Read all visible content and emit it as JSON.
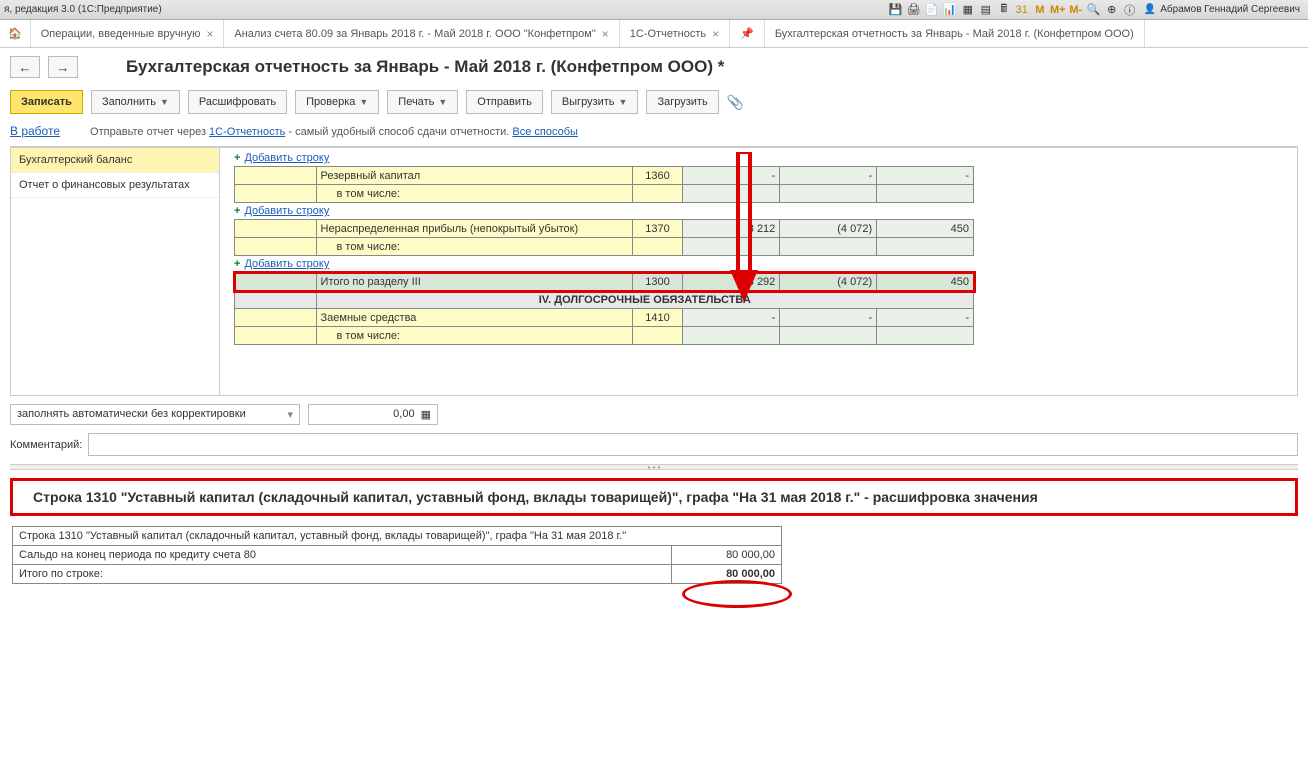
{
  "titlebar": {
    "app": "я, редакция 3.0  (1С:Предприятие)",
    "user": "Абрамов Геннадий Сергеевич",
    "btns": [
      "M",
      "M+",
      "M-"
    ]
  },
  "tabs": {
    "t1": "Операции, введенные вручную",
    "t2": "Анализ счета 80.09 за Январь 2018 г. - Май 2018 г. ООО \"Конфетпром\"",
    "t3": "1С-Отчетность",
    "t4": "Бухгалтерская отчетность за Январь - Май 2018 г. (Конфетпром ООО)"
  },
  "page": {
    "title": "Бухгалтерская отчетность за Январь - Май 2018 г. (Конфетпром ООО) *"
  },
  "toolbar": {
    "save": "Записать",
    "fill": "Заполнить",
    "decode": "Расшифровать",
    "check": "Проверка",
    "print": "Печать",
    "send": "Отправить",
    "upload": "Выгрузить",
    "load": "Загрузить"
  },
  "status": "В работе",
  "info": {
    "pre": "Отправьте отчет через ",
    "link1": "1С-Отчетность",
    "mid": " - самый удобный способ сдачи отчетности. ",
    "link2": "Все способы"
  },
  "leftpanel": {
    "i1": "Бухгалтерский баланс",
    "i2": "Отчет о финансовых результатах"
  },
  "grid": {
    "addrow": "Добавить строку",
    "r1": {
      "lbl": "Резервный капитал",
      "code": "1360",
      "v1": "-",
      "v2": "-",
      "v3": "-"
    },
    "r1b": {
      "lbl": "в том числе:"
    },
    "r2": {
      "lbl": "Нераспределенная прибыль (непокрытый убыток)",
      "code": "1370",
      "v1": "8 212",
      "v2": "(4 072)",
      "v3": "450"
    },
    "r2b": {
      "lbl": "в том числе:"
    },
    "r3": {
      "lbl": "Итого по разделу III",
      "code": "1300",
      "v1": "8 292",
      "v2": "(4 072)",
      "v3": "450"
    },
    "sec": {
      "lbl": "IV. ДОЛГОСРОЧНЫЕ ОБЯЗАТЕЛЬСТВА"
    },
    "r4": {
      "lbl": "Заемные средства",
      "code": "1410",
      "v1": "-",
      "v2": "-",
      "v3": "-"
    },
    "r4b": {
      "lbl": "в том числе:"
    }
  },
  "controls": {
    "mode": "заполнять автоматически без корректировки",
    "amount": "0,00",
    "comment_lbl": "Комментарий:"
  },
  "detail": {
    "title": "Строка 1310 \"Уставный капитал (складочный капитал, уставный фонд, вклады товарищей)\", графа \"На 31 мая 2018 г.\" - расшифровка значения",
    "row1": "Строка 1310 \"Уставный капитал (складочный капитал, уставный фонд, вклады товарищей)\", графа \"На 31 мая 2018 г.\"",
    "row2": "Сальдо на конец периода по кредиту счета 80",
    "val2": "80 000,00",
    "row3": "Итого по строке:",
    "val3": "80 000,00"
  }
}
